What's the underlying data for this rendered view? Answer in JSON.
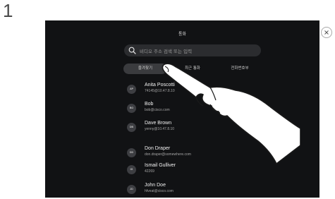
{
  "step_number": "1",
  "screen": {
    "title": "통화",
    "search": {
      "placeholder": "비디오 주소 검색 또는 입력"
    },
    "tabs": [
      {
        "label": "즐겨찾기",
        "active": true
      },
      {
        "label": "최근 통화",
        "active": false
      },
      {
        "label": "전화번호부",
        "active": false
      }
    ],
    "contacts": [
      {
        "initials": "AP",
        "name": "Anita Poscotti",
        "detail": "74145@10.47.8.10"
      },
      {
        "initials": "BO",
        "name": "Bob",
        "detail": "bob@cisco.com"
      },
      {
        "initials": "DB",
        "name": "Dave Brown",
        "detail": "yenny@10.47.8.10"
      },
      {
        "initials": "DD",
        "name": "Don Draper",
        "detail": "don.draper@somewhere.com"
      },
      {
        "initials": "IG",
        "name": "Ismail Gulliver",
        "detail": "42269"
      },
      {
        "initials": "JD",
        "name": "John Doe",
        "detail": "hfveat@cisco.com"
      }
    ]
  },
  "icons": {
    "search": "search-icon",
    "close": "close-icon",
    "hand": "pointing-hand-icon"
  },
  "colors": {
    "screen_background": "#111214",
    "search_background": "#2b2c2f",
    "active_tab": "#3a3b3e",
    "avatar": "#3d3e42"
  }
}
